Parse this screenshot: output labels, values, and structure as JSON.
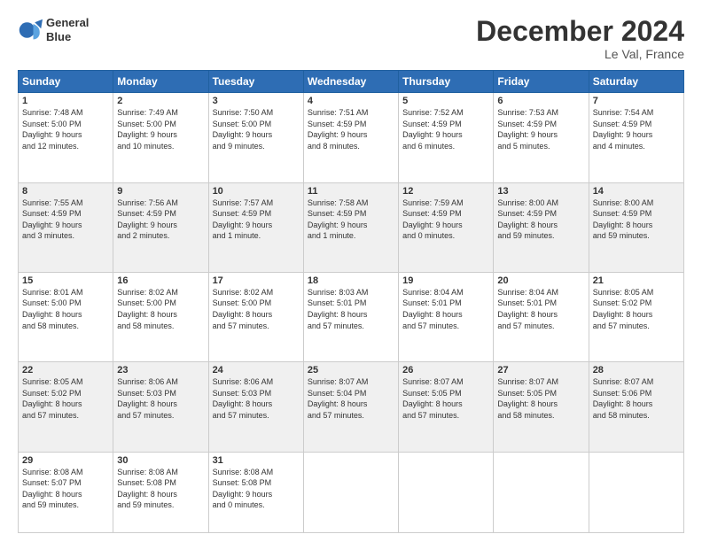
{
  "header": {
    "logo_line1": "General",
    "logo_line2": "Blue",
    "month": "December 2024",
    "location": "Le Val, France"
  },
  "weekdays": [
    "Sunday",
    "Monday",
    "Tuesday",
    "Wednesday",
    "Thursday",
    "Friday",
    "Saturday"
  ],
  "weeks": [
    [
      {
        "day": "1",
        "info": "Sunrise: 7:48 AM\nSunset: 5:00 PM\nDaylight: 9 hours\nand 12 minutes."
      },
      {
        "day": "2",
        "info": "Sunrise: 7:49 AM\nSunset: 5:00 PM\nDaylight: 9 hours\nand 10 minutes."
      },
      {
        "day": "3",
        "info": "Sunrise: 7:50 AM\nSunset: 5:00 PM\nDaylight: 9 hours\nand 9 minutes."
      },
      {
        "day": "4",
        "info": "Sunrise: 7:51 AM\nSunset: 4:59 PM\nDaylight: 9 hours\nand 8 minutes."
      },
      {
        "day": "5",
        "info": "Sunrise: 7:52 AM\nSunset: 4:59 PM\nDaylight: 9 hours\nand 6 minutes."
      },
      {
        "day": "6",
        "info": "Sunrise: 7:53 AM\nSunset: 4:59 PM\nDaylight: 9 hours\nand 5 minutes."
      },
      {
        "day": "7",
        "info": "Sunrise: 7:54 AM\nSunset: 4:59 PM\nDaylight: 9 hours\nand 4 minutes."
      }
    ],
    [
      {
        "day": "8",
        "info": "Sunrise: 7:55 AM\nSunset: 4:59 PM\nDaylight: 9 hours\nand 3 minutes."
      },
      {
        "day": "9",
        "info": "Sunrise: 7:56 AM\nSunset: 4:59 PM\nDaylight: 9 hours\nand 2 minutes."
      },
      {
        "day": "10",
        "info": "Sunrise: 7:57 AM\nSunset: 4:59 PM\nDaylight: 9 hours\nand 1 minute."
      },
      {
        "day": "11",
        "info": "Sunrise: 7:58 AM\nSunset: 4:59 PM\nDaylight: 9 hours\nand 1 minute."
      },
      {
        "day": "12",
        "info": "Sunrise: 7:59 AM\nSunset: 4:59 PM\nDaylight: 9 hours\nand 0 minutes."
      },
      {
        "day": "13",
        "info": "Sunrise: 8:00 AM\nSunset: 4:59 PM\nDaylight: 8 hours\nand 59 minutes."
      },
      {
        "day": "14",
        "info": "Sunrise: 8:00 AM\nSunset: 4:59 PM\nDaylight: 8 hours\nand 59 minutes."
      }
    ],
    [
      {
        "day": "15",
        "info": "Sunrise: 8:01 AM\nSunset: 5:00 PM\nDaylight: 8 hours\nand 58 minutes."
      },
      {
        "day": "16",
        "info": "Sunrise: 8:02 AM\nSunset: 5:00 PM\nDaylight: 8 hours\nand 58 minutes."
      },
      {
        "day": "17",
        "info": "Sunrise: 8:02 AM\nSunset: 5:00 PM\nDaylight: 8 hours\nand 57 minutes."
      },
      {
        "day": "18",
        "info": "Sunrise: 8:03 AM\nSunset: 5:01 PM\nDaylight: 8 hours\nand 57 minutes."
      },
      {
        "day": "19",
        "info": "Sunrise: 8:04 AM\nSunset: 5:01 PM\nDaylight: 8 hours\nand 57 minutes."
      },
      {
        "day": "20",
        "info": "Sunrise: 8:04 AM\nSunset: 5:01 PM\nDaylight: 8 hours\nand 57 minutes."
      },
      {
        "day": "21",
        "info": "Sunrise: 8:05 AM\nSunset: 5:02 PM\nDaylight: 8 hours\nand 57 minutes."
      }
    ],
    [
      {
        "day": "22",
        "info": "Sunrise: 8:05 AM\nSunset: 5:02 PM\nDaylight: 8 hours\nand 57 minutes."
      },
      {
        "day": "23",
        "info": "Sunrise: 8:06 AM\nSunset: 5:03 PM\nDaylight: 8 hours\nand 57 minutes."
      },
      {
        "day": "24",
        "info": "Sunrise: 8:06 AM\nSunset: 5:03 PM\nDaylight: 8 hours\nand 57 minutes."
      },
      {
        "day": "25",
        "info": "Sunrise: 8:07 AM\nSunset: 5:04 PM\nDaylight: 8 hours\nand 57 minutes."
      },
      {
        "day": "26",
        "info": "Sunrise: 8:07 AM\nSunset: 5:05 PM\nDaylight: 8 hours\nand 57 minutes."
      },
      {
        "day": "27",
        "info": "Sunrise: 8:07 AM\nSunset: 5:05 PM\nDaylight: 8 hours\nand 58 minutes."
      },
      {
        "day": "28",
        "info": "Sunrise: 8:07 AM\nSunset: 5:06 PM\nDaylight: 8 hours\nand 58 minutes."
      }
    ],
    [
      {
        "day": "29",
        "info": "Sunrise: 8:08 AM\nSunset: 5:07 PM\nDaylight: 8 hours\nand 59 minutes."
      },
      {
        "day": "30",
        "info": "Sunrise: 8:08 AM\nSunset: 5:08 PM\nDaylight: 8 hours\nand 59 minutes."
      },
      {
        "day": "31",
        "info": "Sunrise: 8:08 AM\nSunset: 5:08 PM\nDaylight: 9 hours\nand 0 minutes."
      },
      {
        "day": "",
        "info": ""
      },
      {
        "day": "",
        "info": ""
      },
      {
        "day": "",
        "info": ""
      },
      {
        "day": "",
        "info": ""
      }
    ]
  ]
}
